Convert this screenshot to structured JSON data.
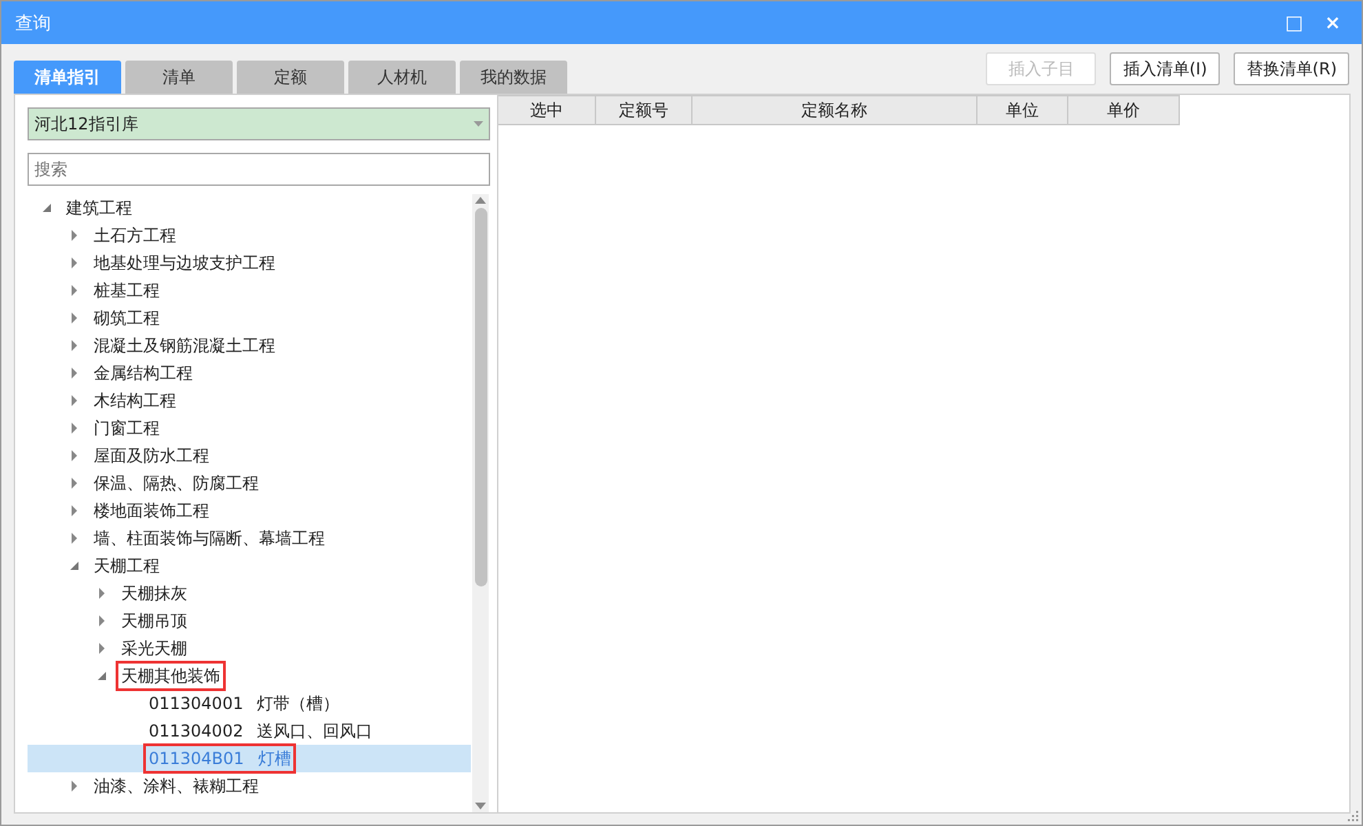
{
  "window": {
    "title": "查询",
    "controls": [
      "□",
      "×"
    ]
  },
  "tabs": [
    {
      "label": "清单指引",
      "selected": true
    },
    {
      "label": "清单",
      "selected": false
    },
    {
      "label": "定额",
      "selected": false
    },
    {
      "label": "人材机",
      "selected": false
    },
    {
      "label": "我的数据",
      "selected": false
    }
  ],
  "library_select": {
    "value": "河北12指引库"
  },
  "search": {
    "placeholder": "搜索"
  },
  "tree": [
    {
      "kind": "branch",
      "label": "建筑工程",
      "expanded": true,
      "selected": false,
      "outlined": false,
      "children": [
        {
          "kind": "branch",
          "label": "土石方工程",
          "expanded": false,
          "selected": false,
          "outlined": false
        },
        {
          "kind": "branch",
          "label": "地基处理与边坡支护工程",
          "expanded": false,
          "selected": false,
          "outlined": false
        },
        {
          "kind": "branch",
          "label": "桩基工程",
          "expanded": false,
          "selected": false,
          "outlined": false
        },
        {
          "kind": "branch",
          "label": "砌筑工程",
          "expanded": false,
          "selected": false,
          "outlined": false
        },
        {
          "kind": "branch",
          "label": "混凝土及钢筋混凝土工程",
          "expanded": false,
          "selected": false,
          "outlined": false
        },
        {
          "kind": "branch",
          "label": "金属结构工程",
          "expanded": false,
          "selected": false,
          "outlined": false
        },
        {
          "kind": "branch",
          "label": "木结构工程",
          "expanded": false,
          "selected": false,
          "outlined": false
        },
        {
          "kind": "branch",
          "label": "门窗工程",
          "expanded": false,
          "selected": false,
          "outlined": false
        },
        {
          "kind": "branch",
          "label": "屋面及防水工程",
          "expanded": false,
          "selected": false,
          "outlined": false
        },
        {
          "kind": "branch",
          "label": "保温、隔热、防腐工程",
          "expanded": false,
          "selected": false,
          "outlined": false
        },
        {
          "kind": "branch",
          "label": "楼地面装饰工程",
          "expanded": false,
          "selected": false,
          "outlined": false
        },
        {
          "kind": "branch",
          "label": "墙、柱面装饰与隔断、幕墙工程",
          "expanded": false,
          "selected": false,
          "outlined": false
        },
        {
          "kind": "branch",
          "label": "天棚工程",
          "expanded": true,
          "selected": false,
          "outlined": false,
          "children": [
            {
              "kind": "branch",
              "label": "天棚抹灰",
              "expanded": false,
              "selected": false,
              "outlined": false
            },
            {
              "kind": "branch",
              "label": "天棚吊顶",
              "expanded": false,
              "selected": false,
              "outlined": false
            },
            {
              "kind": "branch",
              "label": "采光天棚",
              "expanded": false,
              "selected": false,
              "outlined": false
            },
            {
              "kind": "branch",
              "label": "天棚其他装饰",
              "expanded": true,
              "selected": false,
              "outlined": true,
              "children": [
                {
                  "kind": "leaf",
                  "code": "011304001",
                  "label": "灯带（槽）",
                  "selected": false,
                  "outlined": false
                },
                {
                  "kind": "leaf",
                  "code": "011304002",
                  "label": "送风口、回风口",
                  "selected": false,
                  "outlined": false
                },
                {
                  "kind": "leaf",
                  "code": "011304B01",
                  "label": "灯槽",
                  "selected": true,
                  "outlined": true
                }
              ]
            }
          ]
        },
        {
          "kind": "branch",
          "label": "油漆、涂料、裱糊工程",
          "expanded": false,
          "selected": false,
          "outlined": false
        }
      ]
    }
  ],
  "buttons": [
    {
      "label": "插入子目",
      "disabled": true
    },
    {
      "label": "插入清单(I)",
      "disabled": false
    },
    {
      "label": "替换清单(R)",
      "disabled": false
    }
  ],
  "table": {
    "columns": [
      "选中",
      "定额号",
      "定额名称",
      "单位",
      "单价"
    ]
  }
}
